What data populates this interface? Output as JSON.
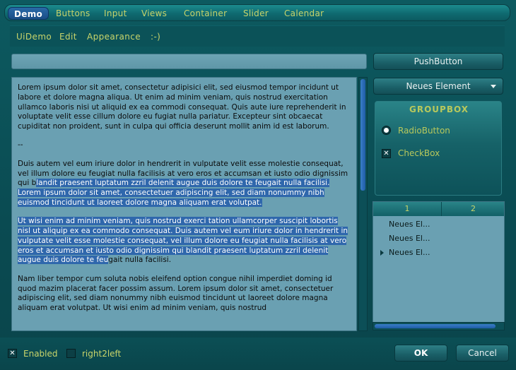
{
  "tabs": [
    {
      "label": "Demo",
      "active": true
    },
    {
      "label": "Buttons"
    },
    {
      "label": "Input"
    },
    {
      "label": "Views"
    },
    {
      "label": "Container"
    },
    {
      "label": "Slider"
    },
    {
      "label": "Calendar"
    }
  ],
  "menu": [
    "UiDemo",
    "Edit",
    "Appearance",
    ":-)"
  ],
  "line_edit": {
    "value": ""
  },
  "push_button": {
    "label": "PushButton"
  },
  "combo": {
    "selected": "Neues Element"
  },
  "text": {
    "p1": "Lorem ipsum dolor sit amet, consectetur adipisici elit, sed eiusmod tempor incidunt ut labore et dolore magna aliqua. Ut enim ad minim veniam, quis nostrud exercitation ullamco laboris nisi ut aliquid ex ea commodi consequat. Quis aute iure reprehenderit in voluptate velit esse cillum dolore eu fugiat nulla pariatur. Excepteur sint obcaecat cupiditat non proident, sunt in culpa qui officia deserunt mollit anim id est laborum.",
    "p2": "--",
    "p3_plain": "Duis autem vel eum iriure dolor in hendrerit in vulputate velit esse molestie consequat, vel illum dolore eu feugiat nulla facilisis at vero eros et accumsan et iusto odio dignissim qui b",
    "p3_selected": "landit praesent luptatum zzril delenit augue duis dolore te feugait nulla facilisi. Lorem ipsum dolor sit amet, consectetuer adipiscing elit, sed diam nonummy nibh euismod tincidunt ut laoreet dolore magna aliquam erat volutpat.",
    "p4_selected": "Ut wisi enim ad minim veniam, quis nostrud exerci tation ullamcorper suscipit lobortis nisl ut aliquip ex ea commodo consequat. Duis autem vel eum iriure dolor in hendrerit in vulputate velit esse molestie consequat, vel illum dolore eu feugiat nulla facilisis at vero eros et accumsan et iusto odio dignissim qui blandit praesent luptatum zzril delenit augue duis dolore te feu",
    "p4_plain": "gait nulla facilisi.",
    "p5": "Nam liber tempor cum soluta nobis eleifend option congue nihil imperdiet doming id quod mazim placerat facer possim assum. Lorem ipsum dolor sit amet, consectetuer adipiscing elit, sed diam nonummy nibh euismod tincidunt ut laoreet dolore magna aliquam erat volutpat. Ut wisi enim ad minim veniam, quis nostrud"
  },
  "groupbox": {
    "title": "GROUPBOX",
    "radio_label": "RadioButton",
    "radio_checked": true,
    "check_label": "CheckBox",
    "check_checked": true
  },
  "tree": {
    "headers": [
      "1",
      "2"
    ],
    "rows": [
      "Neues El...",
      "Neues El...",
      "Neues El..."
    ]
  },
  "bottom": {
    "enabled_label": "Enabled",
    "enabled_checked": true,
    "rtl_label": "right2left",
    "rtl_checked": false,
    "ok_label": "OK",
    "cancel_label": "Cancel"
  },
  "colors": {
    "accent": "#c8d46a",
    "background": "#0b4f55",
    "selection": "#2f67ac",
    "text_bg": "#6aa0b2"
  }
}
